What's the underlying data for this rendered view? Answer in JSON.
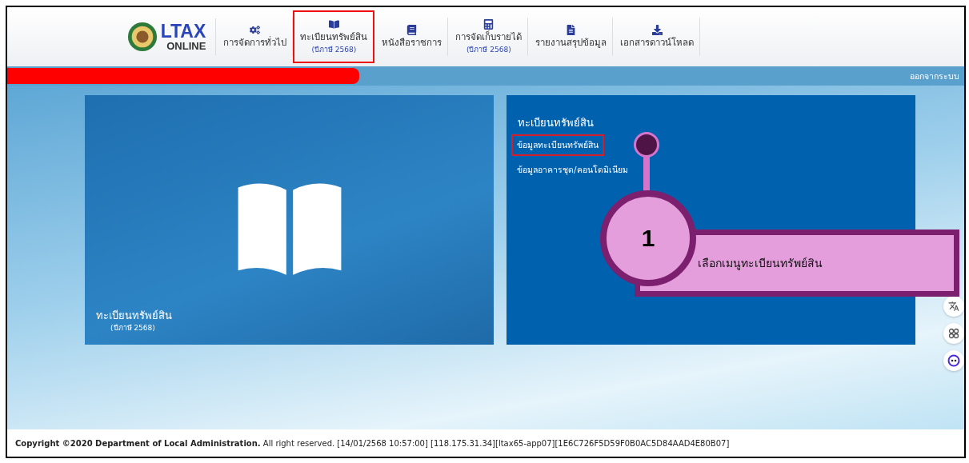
{
  "header": {
    "logo": {
      "title": "LTAX",
      "subtitle": "ONLINE"
    },
    "nav": [
      {
        "kind": "gears",
        "label": "การจัดการทั่วไป",
        "selected": false
      },
      {
        "kind": "openbook",
        "label": "ทะเบียนทรัพย์สิน",
        "sublabel": "(ปีภาษี 2568)",
        "selected": true
      },
      {
        "kind": "book",
        "label": "หนังสือราชการ",
        "selected": false
      },
      {
        "kind": "calculator",
        "label": "การจัดเก็บรายได้",
        "sublabel": "(ปีภาษี 2568)",
        "selected": false
      },
      {
        "kind": "file",
        "label": "รายงานสรุปข้อมูล",
        "selected": false
      },
      {
        "kind": "download",
        "label": "เอกสารดาวน์โหลด",
        "selected": false
      }
    ]
  },
  "user_bar": {
    "logout": "ออกจากระบบ"
  },
  "image_card": {
    "title": "ทะเบียนทรัพย์สิน",
    "subtitle": "(ปีภาษี 2568)"
  },
  "menu_card": {
    "title": "ทะเบียนทรัพย์สิน",
    "links": [
      {
        "label": "ข้อมูลทะเบียนทรัพย์สิน",
        "selected": true
      },
      {
        "label": "ข้อมูลอาคารชุด/คอนโดมิเนียม",
        "selected": false
      }
    ]
  },
  "callout": {
    "number": "1",
    "text": "เลือกเมนูทะเบียนทรัพย์สิน"
  },
  "footer": {
    "text": "**Copyright ©2020 Department of Local Administration.** All right reserved. [14/01/2568 10:57:00] [118.175.31.34][ltax65-app07][1E6C726F5D59F0B0AC5D84AAD4E80B07]"
  }
}
